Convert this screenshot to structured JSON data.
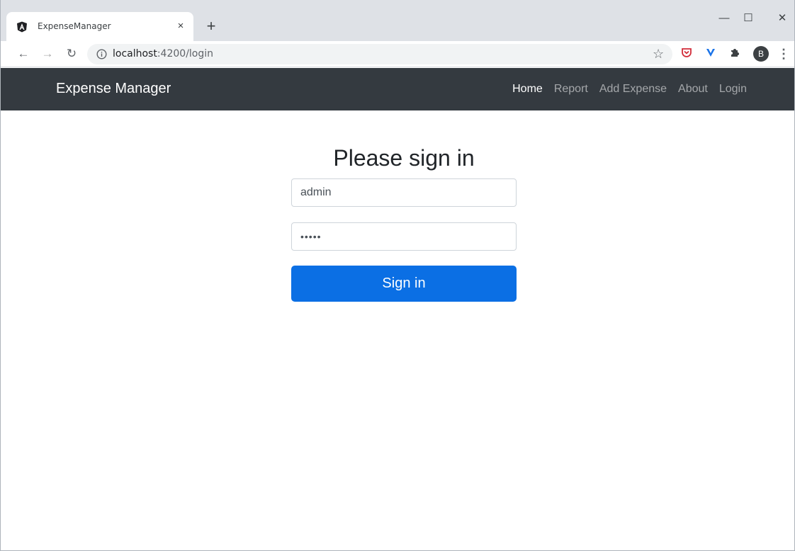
{
  "browser": {
    "tab_title": "ExpenseManager",
    "tab_favicon": "angular-icon",
    "new_tab": "+",
    "close_tab": "×",
    "url_host": "localhost",
    "url_path": ":4200/login",
    "window_controls": {
      "minimize": "—",
      "maximize": "☐",
      "close": "✕"
    },
    "profile_initial": "B",
    "icons": [
      "back-icon",
      "forward-icon",
      "reload-icon",
      "info-icon",
      "star-icon",
      "pocket-icon",
      "vpn-icon",
      "puzzle-icon",
      "menu-icon"
    ]
  },
  "navbar": {
    "brand": "Expense Manager",
    "links": [
      {
        "label": "Home",
        "active": true
      },
      {
        "label": "Report",
        "active": false
      },
      {
        "label": "Add Expense",
        "active": false
      },
      {
        "label": "About",
        "active": false
      },
      {
        "label": "Login",
        "active": false
      }
    ]
  },
  "login": {
    "title": "Please sign in",
    "username_value": "admin",
    "password_value": "•••••",
    "submit_label": "Sign in"
  },
  "colors": {
    "navbar_bg": "#343a40",
    "primary_button": "#0b6fe4",
    "tabstrip_bg": "#dee1e6"
  }
}
